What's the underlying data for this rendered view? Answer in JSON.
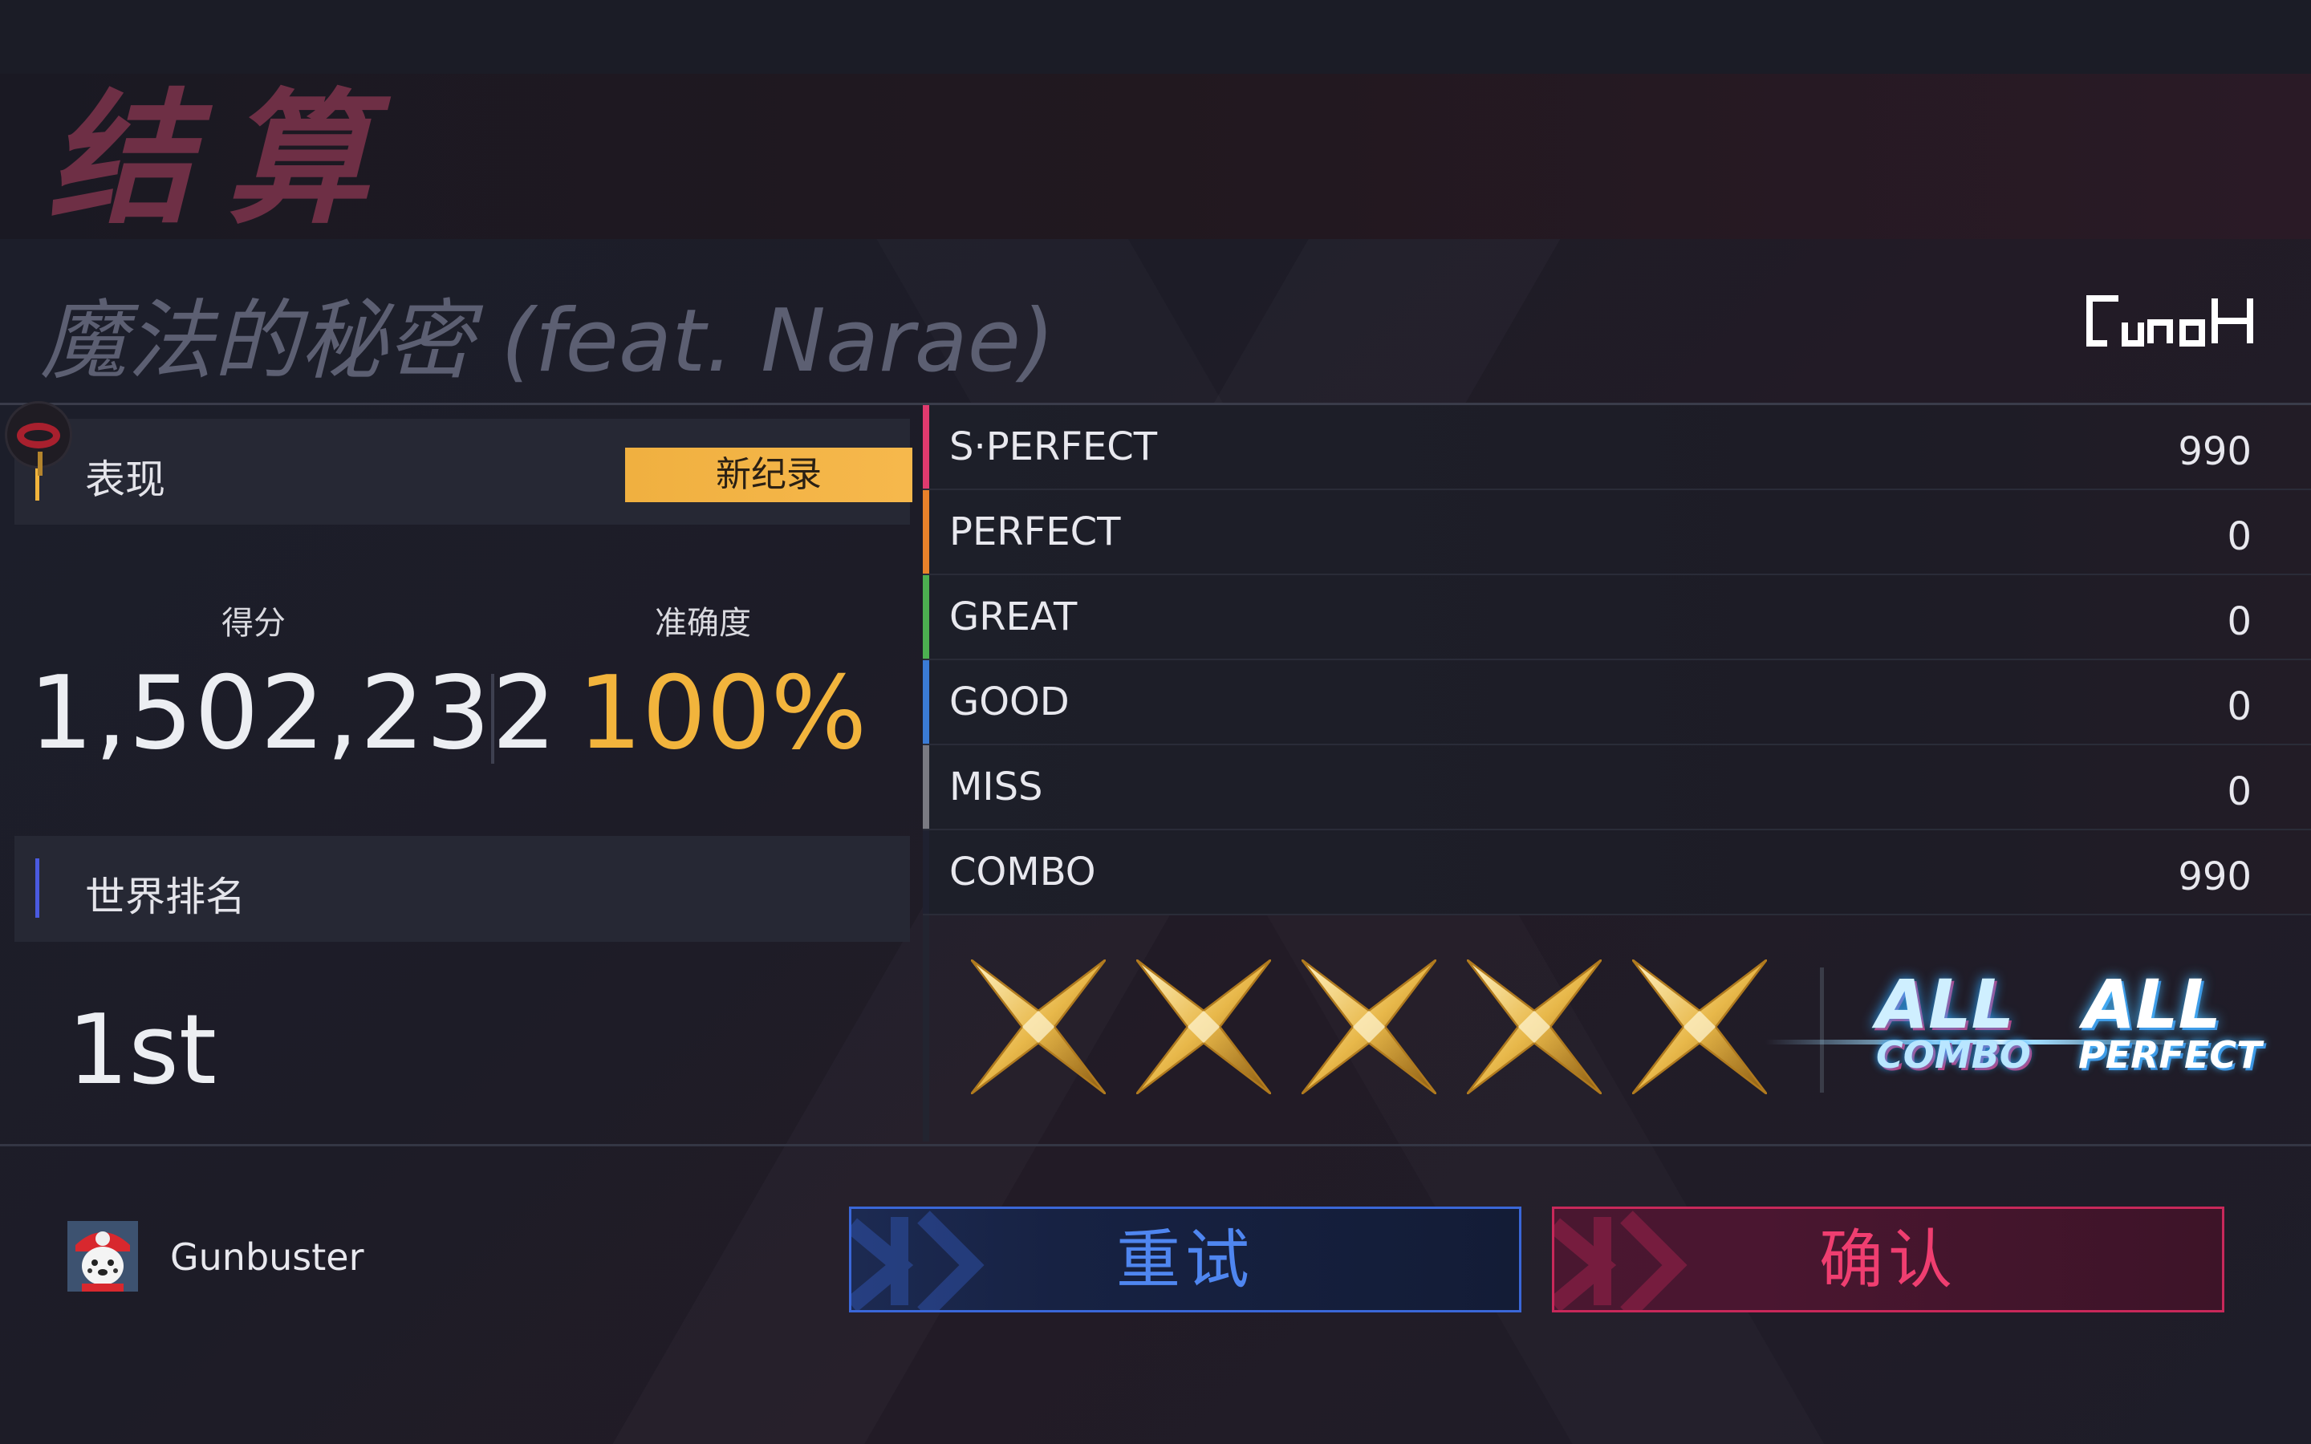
{
  "header": {
    "title": "结算"
  },
  "song": {
    "title": "魔法的秘密 (feat. Narae)"
  },
  "performance": {
    "section_label": "表现",
    "new_record_badge": "新纪录",
    "score_label": "得分",
    "score_value": "1,502,232",
    "accuracy_label": "准确度",
    "accuracy_value": "100%"
  },
  "world_rank": {
    "section_label": "世界排名",
    "value": "1st"
  },
  "judgements": [
    {
      "name": "S·PERFECT",
      "value": "990",
      "color": "#e03a6e"
    },
    {
      "name": "PERFECT",
      "value": "0",
      "color": "#e8812a"
    },
    {
      "name": "GREAT",
      "value": "0",
      "color": "#4caf50"
    },
    {
      "name": "GOOD",
      "value": "0",
      "color": "#3a7bd5"
    },
    {
      "name": "MISS",
      "value": "0",
      "color": "#7a7a82"
    },
    {
      "name": "COMBO",
      "value": "990",
      "color": "#1f2130"
    }
  ],
  "rating": {
    "stars": 5,
    "star_color": "#e8b84a"
  },
  "badges": {
    "all_combo_top": "ALL",
    "all_combo_bottom": "COMBO",
    "all_perfect_top": "ALL",
    "all_perfect_bottom": "PERFECT"
  },
  "player": {
    "name": "Gunbuster",
    "avatar_icon": "avatar-icon"
  },
  "buttons": {
    "retry": "重试",
    "confirm": "确认"
  },
  "colors": {
    "accent_gold": "#f2b43c",
    "retry_blue": "#3a67d8",
    "confirm_pink": "#c8285a",
    "rank_bar": "#4a5ae0"
  }
}
